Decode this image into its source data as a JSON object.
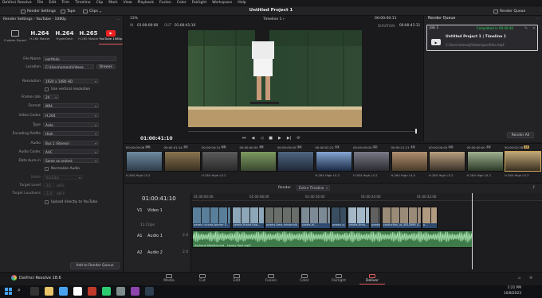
{
  "menubar": {
    "items": [
      "DaVinci Resolve",
      "File",
      "Edit",
      "Trim",
      "Timeline",
      "Clip",
      "Mark",
      "View",
      "Playback",
      "Fusion",
      "Color",
      "Fairlight",
      "Workspace",
      "Help"
    ]
  },
  "toolbar": {
    "render_settings": "Render Settings",
    "tape": "Tape",
    "clips": "Clips",
    "project_title": "Untitled Project 1",
    "render_queue": "Render Queue"
  },
  "render_settings": {
    "header": "Render Settings - YouTube - 1080p",
    "presets": [
      {
        "big": "",
        "small": "Custom Export"
      },
      {
        "big": "H.264",
        "small": "H.264 Master"
      },
      {
        "big": "H.264",
        "small": "HyperDeck"
      },
      {
        "big": "H.265",
        "small": "H.265 Master"
      },
      {
        "big": "",
        "small": "YouTube 1080p"
      }
    ],
    "file_name_label": "File Name",
    "file_name": "portfolio",
    "location_label": "Location",
    "location": "C:\\Users\\omarg\\Videos",
    "browse": "Browse",
    "resolution_label": "Resolution",
    "resolution": "1920 x 1080 HD",
    "vertical_res": "Use vertical resolution",
    "frame_rate_label": "Frame rate",
    "frame_rate": "24",
    "format_label": "Format",
    "format": "MP4",
    "video_codec_label": "Video Codec",
    "video_codec": "H.264",
    "type_label": "Type",
    "type": "Auto",
    "encoding_profile_label": "Encoding Profile",
    "encoding_profile": "High",
    "audio_label": "Audio",
    "audio": "Bus 1 (Stereo)",
    "audio_codec_label": "Audio Codec",
    "audio_codec": "AAC",
    "data_burn_label": "Data burn-in",
    "data_burn": "Same as project",
    "normalize": "Normalize Audio",
    "mode_label": "Mode",
    "mode": "YouTube",
    "target_level_label": "Target Level",
    "target_level": "-14",
    "target_level_unit": "LKFS",
    "target_loudness_label": "Target Loudness",
    "target_loudness": "-1.0",
    "target_loudness_unit": "dBTP",
    "upload": "Upload directly to YouTube",
    "add_queue": "Add to Render Queue"
  },
  "viewer": {
    "zoom": "33%",
    "timeline_name": "Timeline 1",
    "timecode_top": "00:00:00:11",
    "in_label": "IN",
    "in_tc": "01:00:00:00",
    "out_label": "OUT",
    "out_tc": "01:00:41:10",
    "duration_label": "DURATION",
    "duration_tc": "00:00:41:11",
    "current_tc": "01:00:41:10"
  },
  "render_queue": {
    "title": "Render Queue",
    "job": "Job 1",
    "job_status": "Completed in 00:00:46",
    "job_title": "Untitled Project 1 | Timeline 1",
    "job_path": "C:\\Users\\omarg\\Videos\\portfolio.mp4",
    "render_all": "Render All"
  },
  "clips": [
    {
      "num": "06",
      "tc": "00:00:00:06",
      "codec": "H.264 High L5.2"
    },
    {
      "num": "07",
      "tc": "00:00:01:14",
      "codec": ""
    },
    {
      "num": "08",
      "tc": "00:00:04:14",
      "codec": "H.264 High L5.2"
    },
    {
      "num": "09",
      "tc": "00:00:00:00",
      "codec": ""
    },
    {
      "num": "10",
      "tc": "00:00:00:00",
      "codec": ""
    },
    {
      "num": "11",
      "tc": "00:00:02:21",
      "codec": "H.264 High L5.2"
    },
    {
      "num": "12",
      "tc": "00:00:00:00",
      "codec": "H.264 High L4.2"
    },
    {
      "num": "13",
      "tc": "00:00:11:11",
      "codec": "H.264 High L4.0"
    },
    {
      "num": "14",
      "tc": "00:00:00:00",
      "codec": "H.264 High L5.2"
    },
    {
      "num": "15",
      "tc": "00:00:00:00",
      "codec": "H.264 High L5.2"
    },
    {
      "num": "16",
      "tc": "00:00:02:28",
      "codec": "H.264 High L5.2"
    }
  ],
  "timeline": {
    "timecode": "01:00:41:10",
    "render_label": "Render",
    "render_value": "Entire Timeline",
    "ruler": [
      "01:00:00:00",
      "01:00:08:00",
      "01:00:16:00",
      "01:00:24:00",
      "01:00:32:00"
    ],
    "v1_id": "V1",
    "v1_name": "Video 1",
    "v1_clips": "11 Clips",
    "a1_id": "A1",
    "a1_name": "Audio 1",
    "a1_level": "2.0",
    "a2_id": "A2",
    "a2_name": "Audio 2",
    "a2_level": "2.0",
    "video_clips": [
      "pexels-nicolas-becker-5...",
      "pexels-thanh-hoa...",
      "pexels-tima-miroshnik...",
      "pexels-iri...",
      "pexels-vi...",
      "pexels-tima...",
      "pexels-...",
      "production_id_4812898 (2...",
      "p..."
    ],
    "audio_clip": "Sorhene Mastermind - Lovely Soul.mp3"
  },
  "pages": [
    "Media",
    "Cut",
    "Edit",
    "Fusion",
    "Color",
    "Fairlight",
    "Deliver"
  ],
  "brand": "DaVinci Resolve 18.6",
  "taskbar": {
    "time": "1:21 PM",
    "date": "10/8/2023"
  },
  "colors": {
    "accent": "#e05a5a",
    "success": "#2ed158",
    "video_clip": "#2e4a6e",
    "audio_clip": "#3e7a4a",
    "playhead": "#d9d9dc"
  }
}
